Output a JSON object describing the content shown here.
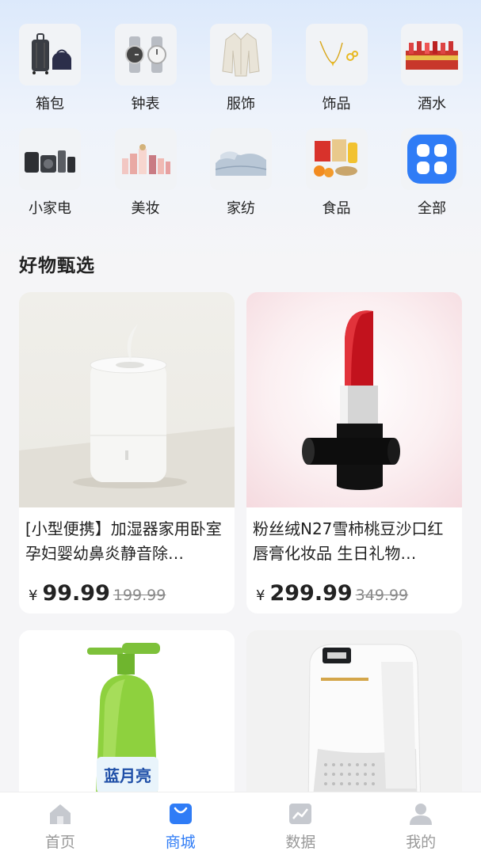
{
  "categories": [
    {
      "label": "箱包",
      "icon": "luggage-icon"
    },
    {
      "label": "钟表",
      "icon": "watch-icon"
    },
    {
      "label": "服饰",
      "icon": "clothing-icon"
    },
    {
      "label": "饰品",
      "icon": "necklace-icon"
    },
    {
      "label": "酒水",
      "icon": "liquor-icon"
    },
    {
      "label": "小家电",
      "icon": "appliance-icon"
    },
    {
      "label": "美妆",
      "icon": "cosmetics-icon"
    },
    {
      "label": "家纺",
      "icon": "bedding-icon"
    },
    {
      "label": "食品",
      "icon": "food-icon"
    },
    {
      "label": "全部",
      "icon": "grid-all-icon"
    }
  ],
  "section": {
    "title": "好物甄选"
  },
  "products": [
    {
      "title": "[小型便携】加湿器家用卧室孕妇婴幼鼻炎静音除…",
      "currency": "¥",
      "price": "99.99",
      "original_price": "199.99",
      "image": "humidifier-image"
    },
    {
      "title": "粉丝绒N27雪柿桃豆沙口红唇膏化妆品 生日礼物…",
      "currency": "¥",
      "price": "299.99",
      "original_price": "349.99",
      "image": "lipstick-image"
    },
    {
      "title": "",
      "image": "hand-soap-image",
      "brand_text": "蓝月亮"
    },
    {
      "title": "",
      "image": "air-purifier-image"
    }
  ],
  "tabbar": [
    {
      "label": "首页",
      "icon": "home-icon",
      "active": false
    },
    {
      "label": "商城",
      "icon": "shopping-bag-icon",
      "active": true
    },
    {
      "label": "数据",
      "icon": "chart-icon",
      "active": false
    },
    {
      "label": "我的",
      "icon": "user-icon",
      "active": false
    }
  ],
  "colors": {
    "accent": "#2f7cf6",
    "inactive": "#999999",
    "background": "#f5f5f7"
  }
}
